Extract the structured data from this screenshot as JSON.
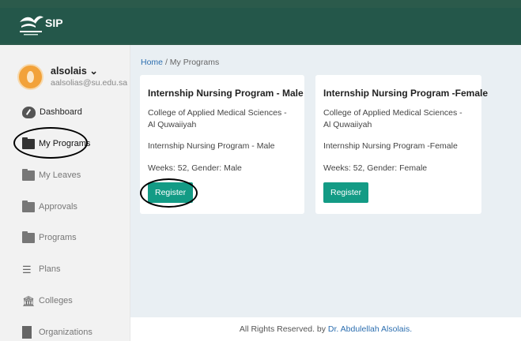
{
  "app": {
    "name": "SIP",
    "logo_icon": "university-logo-icon",
    "header_color": "#24574a"
  },
  "user": {
    "name": "alsolais",
    "caret": "⌄",
    "email": "aalsolias@su.edu.sa"
  },
  "sidebar": {
    "items": [
      {
        "label": "Dashboard",
        "icon": "dashboard-gauge-icon"
      },
      {
        "label": "My Programs",
        "icon": "folder-icon",
        "active": true
      },
      {
        "label": "My Leaves",
        "icon": "folder-icon"
      },
      {
        "label": "Approvals",
        "icon": "folder-icon"
      },
      {
        "label": "Programs",
        "icon": "folder-icon"
      },
      {
        "label": "Plans",
        "icon": "list-icon"
      },
      {
        "label": "Colleges",
        "icon": "building-icon"
      },
      {
        "label": "Organizations",
        "icon": "organization-icon"
      }
    ]
  },
  "breadcrumb": {
    "home": "Home",
    "separator": "/",
    "current": "My Programs"
  },
  "programs": [
    {
      "title": "Internship Nursing Program - Male",
      "college": "College of Applied Medical Sciences - Al Quwaiiyah",
      "name": "Internship Nursing Program - Male",
      "meta": "Weeks: 52, Gender: Male",
      "button": "Register"
    },
    {
      "title": "Internship Nursing Program -Female",
      "college": "College of Applied Medical Sciences - Al Quwaiiyah",
      "name": "Internship Nursing Program -Female",
      "meta": "Weeks: 52, Gender: Female",
      "button": "Register"
    }
  ],
  "footer": {
    "text": "All Rights Reserved. by ",
    "author": "Dr. Abdulellah Alsolais."
  },
  "colors": {
    "accent": "#139b85",
    "link": "#2d6fb0"
  }
}
